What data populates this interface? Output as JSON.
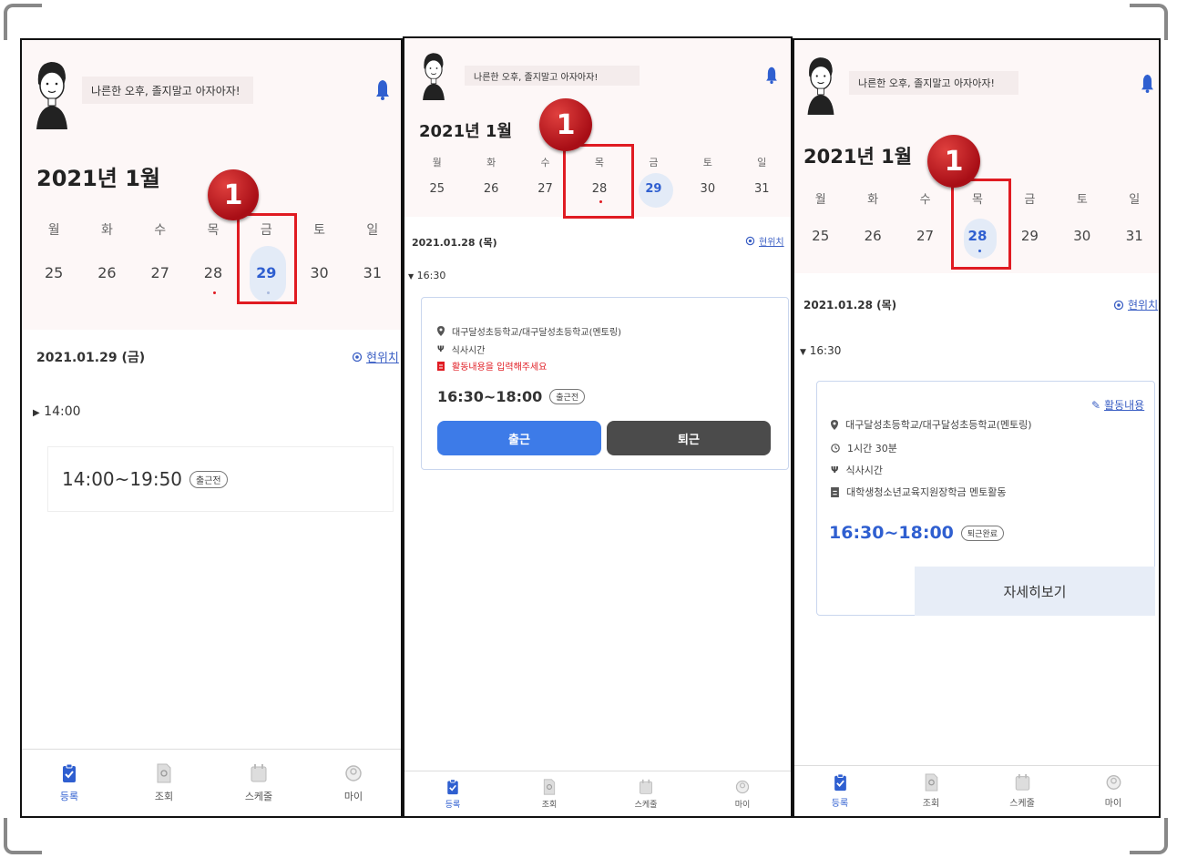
{
  "callout": "1",
  "greeting": "나른한 오후, 졸지말고 아자아자!",
  "month_title": "2021년 1월",
  "weekdays": [
    "월",
    "화",
    "수",
    "목",
    "금",
    "토",
    "일"
  ],
  "dates": [
    "25",
    "26",
    "27",
    "28",
    "29",
    "30",
    "31"
  ],
  "location_label": "현위치",
  "nav": {
    "register": "등록",
    "lookup": "조회",
    "schedule": "스케줄",
    "my": "마이"
  },
  "colors": {
    "accent": "#2f5fd0",
    "highlight_box": "#e01b22",
    "checkin_button": "#3d7be8",
    "checkout_button": "#4b4b4b"
  },
  "screens": [
    {
      "selected_date": "29",
      "date_label": "2021.01.29 (금)",
      "time_toggle": "14:00",
      "toggle_state": "collapsed",
      "card": {
        "time_range": "14:00~19:50",
        "status": "출근전"
      }
    },
    {
      "selected_date": "28",
      "date_label": "2021.01.28 (목)",
      "time_toggle": "16:30",
      "toggle_state": "expanded",
      "card": {
        "place": "대구달성초등학교/대구달성초등학교(멘토링)",
        "meal": "식사시간",
        "warning": "활동내용을 입력해주세요",
        "time_range": "16:30~18:00",
        "status": "출근전",
        "checkin": "출근",
        "checkout": "퇴근"
      }
    },
    {
      "selected_date": "28",
      "date_label": "2021.01.28 (목)",
      "time_toggle": "16:30",
      "toggle_state": "expanded",
      "card": {
        "activity_link": "활동내용",
        "place": "대구달성초등학교/대구달성초등학교(멘토링)",
        "duration": "1시간 30분",
        "meal": "식사시간",
        "program": "대학생청소년교육지원장학금 멘토활동",
        "time_range": "16:30~18:00",
        "status": "퇴근완료",
        "detail": "자세히보기"
      }
    }
  ]
}
